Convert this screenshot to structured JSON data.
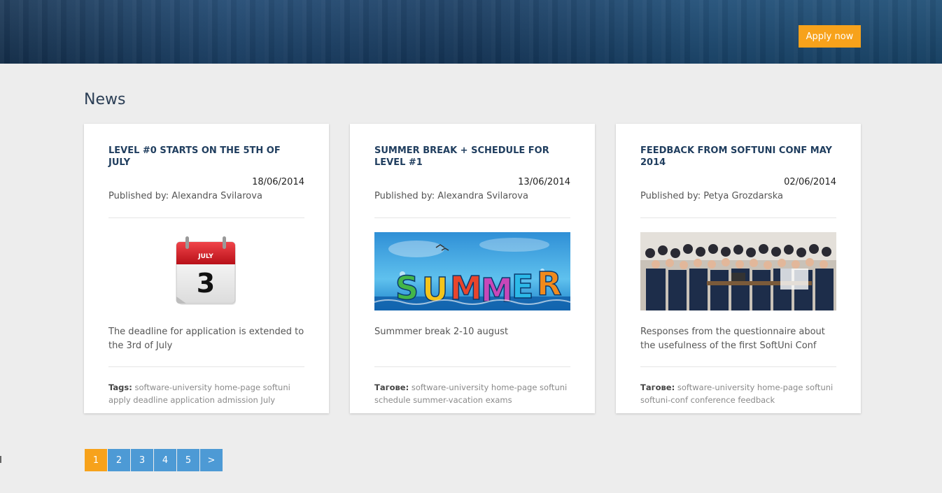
{
  "header": {
    "apply_label": "Apply now"
  },
  "section": {
    "title": "News"
  },
  "news": [
    {
      "title": "Level #0 starts on the 5th of July",
      "date": "18/06/2014",
      "author": "Published by: Alexandra Svilarova",
      "image": "calendar-july-3",
      "calendar_month": "JULY",
      "calendar_day": "3",
      "description": "The deadline for application is extended to the 3rd of July",
      "tags_label": "Tags:",
      "tags": "software-university home-page softuni apply deadline application admission July"
    },
    {
      "title": "Summer Break + Schedule for Level #1",
      "date": "13/06/2014",
      "author": "Published by: Alexandra Svilarova",
      "image": "summer-banner",
      "description": "Summmer break 2-10 august",
      "tags_label": "Тагове:",
      "tags": "software-university home-page softuni schedule summer-vacation exams"
    },
    {
      "title": "Feedback from SoftUni Conf May 2014",
      "date": "02/06/2014",
      "author": "Published by: Petya Grozdarska",
      "image": "conference-group-photo",
      "description": "Responses from the questionnaire about the usefulness of the first SoftUni Conf",
      "tags_label": "Тагове:",
      "tags": "software-university home-page softuni softuni-conf conference feedback"
    }
  ],
  "pagination": {
    "pages": [
      "1",
      "2",
      "3",
      "4",
      "5"
    ],
    "next": ">",
    "current": "1"
  },
  "colors": {
    "accent": "#f7a21b",
    "pager_blue": "#4d9ad5",
    "title_navy": "#1f3d5e"
  }
}
